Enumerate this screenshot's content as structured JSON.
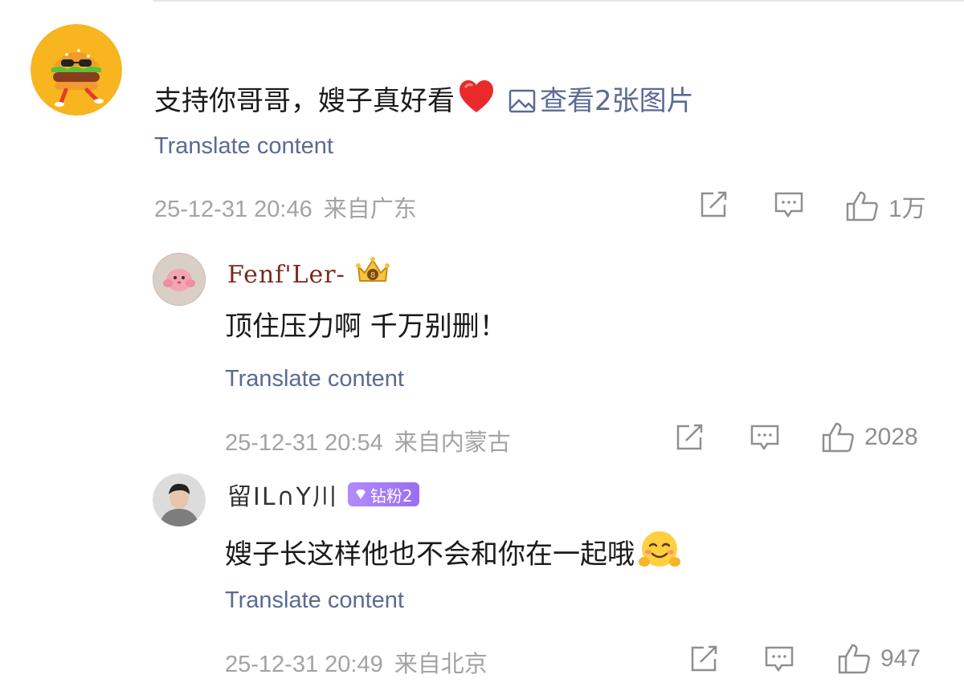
{
  "comments": [
    {
      "text": "支持你哥哥，嫂子真好看",
      "emoji": "red-heart",
      "view_images_label": "查看2张图片",
      "translate": "Translate content",
      "timestamp": "25-12-31 20:46",
      "location": "来自广东",
      "likes": "1万",
      "avatar": "burger-character"
    },
    {
      "username": "Fenf'Ler-",
      "user_badge": "crown-level-badge",
      "text": "顶住压力啊 千万别删！",
      "translate": "Translate content",
      "timestamp": "25-12-31 20:54",
      "location": "来自内蒙古",
      "likes": "2028",
      "avatar": "pink-blob-character"
    },
    {
      "username": "留IL∩Y川",
      "badge_label": "钻粉2",
      "text": "嫂子长这样他也不会和你在一起哦",
      "emoji": "blushing-hug-face",
      "translate": "Translate content",
      "timestamp": "25-12-31 20:49",
      "location": "来自北京",
      "likes": "947",
      "avatar": "young-man-photo"
    }
  ],
  "colors": {
    "link": "#5b6a94",
    "meta": "#a3a3a3",
    "text": "#1a1a1a",
    "badge": "#a07af7",
    "avatar_orange": "#f8b51f"
  }
}
